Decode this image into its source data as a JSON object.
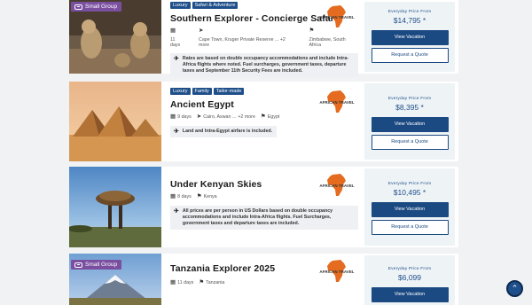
{
  "cards": [
    {
      "badge": "Small Group",
      "tags": [
        "Luxury",
        "Safari & Adventure"
      ],
      "title": "Southern Explorer - Concierge Safari",
      "duration": "11 days",
      "locations": "Cape Town, Kruger Private Reserve ...",
      "more": "+2 more",
      "countries": "Zimbabwe, South Africa",
      "note": "Rates are based on double occupancy accommodations and include Intra-Africa flights where noted. Fuel surcharges, government taxes, departure taxes and September 11th Security Fees are included.",
      "price_from": "Everyday Price From",
      "price": "$14,795 *",
      "view": "View Vacation",
      "quote": "Request a Quote"
    },
    {
      "badge": "",
      "tags": [
        "Luxury",
        "Family",
        "Tailor-made"
      ],
      "title": "Ancient Egypt",
      "duration": "9 days",
      "locations": "Cairo, Aswan ...",
      "more": "+2 more",
      "countries": "Egypt",
      "note": "Land and Intra-Egypt airfare is included.",
      "price_from": "Everyday Price From",
      "price": "$8,395 *",
      "view": "View Vacation",
      "quote": "Request a Quote"
    },
    {
      "badge": "",
      "tags": [],
      "title": "Under Kenyan Skies",
      "duration": "8 days",
      "countries": "Kenya",
      "note": "All prices are per person in US Dollars based on double occupancy accommodations and include Intra-Africa flights. Fuel Surcharges, government taxes and departure taxes are included.",
      "price_from": "Everyday Price From",
      "price": "$10,495 *",
      "view": "View Vacation",
      "quote": "Request a Quote"
    },
    {
      "badge": "Small Group",
      "tags": [],
      "title": "Tanzania Explorer 2025",
      "duration": "11 days",
      "countries": "Tanzania",
      "price_from": "Everyday Price From",
      "price": "$6,099",
      "view": "View Vacation"
    }
  ],
  "logo_text": "AFRICAN TRAVEL",
  "icons": {
    "calendar": "calendar-icon",
    "location": "location-arrow-icon",
    "flag": "flag-icon",
    "plane": "plane-icon",
    "scroll": "chevron-up-icon"
  },
  "colors": {
    "accent": "#1b4a82",
    "badge": "#7a4fa0",
    "logo": "#e46b1f"
  }
}
